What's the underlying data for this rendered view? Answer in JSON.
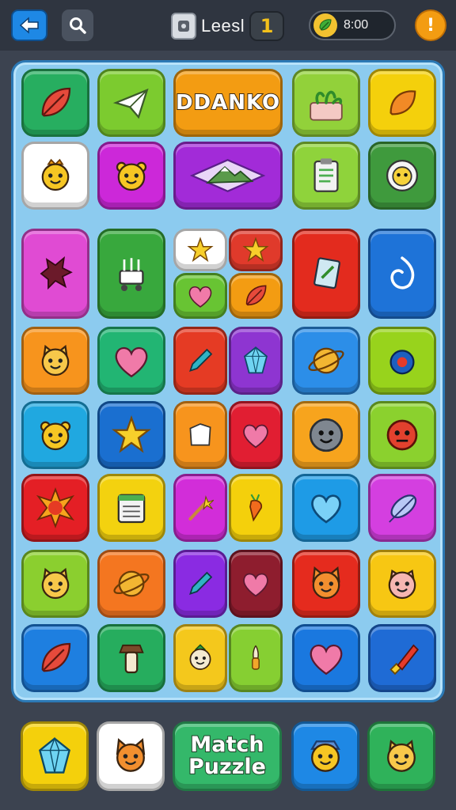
{
  "header": {
    "back_icon": "arrow-back-icon",
    "search_icon": "search-icon",
    "level_label": "Leesl",
    "level_number": "1",
    "coins_text": "8:00",
    "info_symbol": "!"
  },
  "board": {
    "banner_text": "DDANKO",
    "tiles": [
      {
        "icon": "leaf-icon",
        "color": "#27ae60"
      },
      {
        "icon": "paper-plane-icon",
        "color": "#7ccb2f"
      },
      {
        "icon": "banner-tile",
        "color": "#f39c12"
      },
      {
        "icon": "plant-icon",
        "color": "#92d13a"
      },
      {
        "icon": "orange-leaf-icon",
        "color": "#f4d00c"
      },
      {
        "icon": "crowned-face-icon",
        "color": "#ffffff"
      },
      {
        "icon": "bear-face-icon",
        "color": "#cc28d9"
      },
      {
        "icon": "mountain-icon",
        "color": "#a22bd8"
      },
      {
        "icon": "clipboard-icon",
        "color": "#8fd33b"
      },
      {
        "icon": "sheep-icon",
        "color": "#3f9a3d"
      },
      {
        "icon": "splat-icon",
        "color": "#e04bd3"
      },
      {
        "icon": "cart-icon",
        "color": "#38a83d"
      },
      {
        "icon": "star-icon",
        "color": "#ffffff"
      },
      {
        "icon": "star-icon",
        "color": "#e03a2b"
      },
      {
        "icon": "heart-icon",
        "color": "#68c433"
      },
      {
        "icon": "leaf-icon",
        "color": "#f39c12"
      },
      {
        "icon": "note-icon",
        "color": "#e32b1e"
      },
      {
        "icon": "rope-icon",
        "color": "#1e73d8"
      },
      {
        "icon": "cat-face-icon",
        "color": "#f7941d"
      },
      {
        "icon": "heart-icon",
        "color": "#22b573"
      },
      {
        "icon": "pencil-icon",
        "color": "#e53b24"
      },
      {
        "icon": "gem-icon",
        "color": "#8e35d1"
      },
      {
        "icon": "planet-icon",
        "color": "#2c8ee8"
      },
      {
        "icon": "bird-icon",
        "color": "#98d31c"
      },
      {
        "icon": "bear-face-icon",
        "color": "#20a8e0"
      },
      {
        "icon": "star-icon",
        "color": "#1a6fd0"
      },
      {
        "icon": "paper-icon",
        "color": "#f7941d"
      },
      {
        "icon": "heart-icon",
        "color": "#e11e32"
      },
      {
        "icon": "smiley-icon",
        "color": "#f7a41d"
      },
      {
        "icon": "monster-icon",
        "color": "#8bd12e"
      },
      {
        "icon": "sun-icon",
        "color": "#e41f25"
      },
      {
        "icon": "calendar-icon",
        "color": "#f3d20f"
      },
      {
        "icon": "wand-icon",
        "color": "#d22dd9"
      },
      {
        "icon": "carrot-icon",
        "color": "#f4d00c"
      },
      {
        "icon": "heart-outline-icon",
        "color": "#1e9be6"
      },
      {
        "icon": "feather-icon",
        "color": "#d43fe0"
      },
      {
        "icon": "cat-face-icon",
        "color": "#8bcf2f"
      },
      {
        "icon": "planet-icon",
        "color": "#f47620"
      },
      {
        "icon": "pencil-icon",
        "color": "#8a2be2"
      },
      {
        "icon": "heart-icon",
        "color": "#8e1d2e"
      },
      {
        "icon": "fox-face-icon",
        "color": "#e52b1e"
      },
      {
        "icon": "pig-face-icon",
        "color": "#f7c713"
      },
      {
        "icon": "leaf-icon",
        "color": "#1e7fe0"
      },
      {
        "icon": "mushroom-icon",
        "color": "#26ad5e"
      },
      {
        "icon": "carrot-face-icon",
        "color": "#f4c81c"
      },
      {
        "icon": "brush-icon",
        "color": "#86cf32"
      },
      {
        "icon": "heart-icon",
        "color": "#1a78df"
      },
      {
        "icon": "paintbrush-icon",
        "color": "#1f6bd5"
      }
    ]
  },
  "footer": {
    "items": [
      {
        "icon": "gem-icon",
        "color": "#f4d00c"
      },
      {
        "icon": "fox-face-icon",
        "color": "#ffffff"
      },
      {
        "icon": "match-puzzle-button",
        "color": "#34b86a"
      },
      {
        "icon": "hat-face-icon",
        "color": "#1e88e5"
      },
      {
        "icon": "cat-face-icon",
        "color": "#2fb25a"
      }
    ],
    "match_line1": "Match",
    "match_line2": "Puzzle"
  }
}
